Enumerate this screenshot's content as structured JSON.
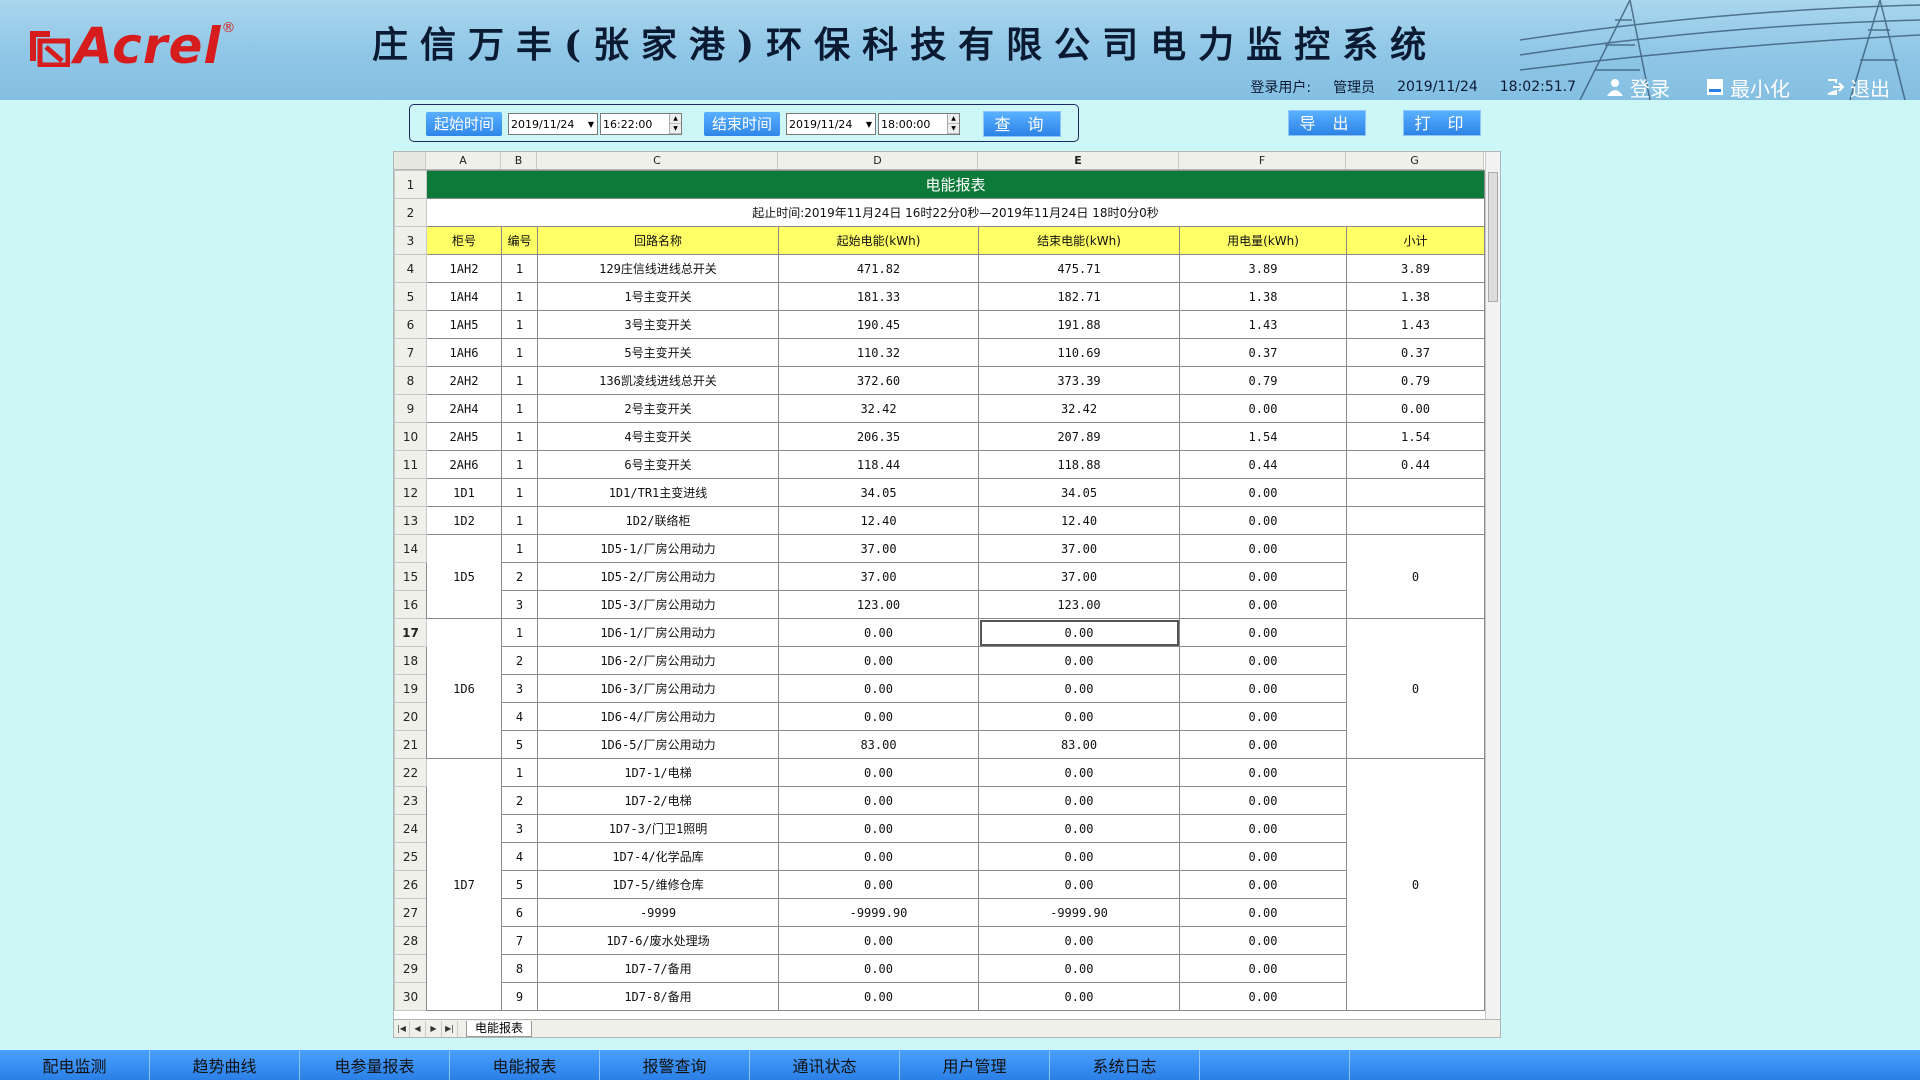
{
  "header": {
    "logo_text": "Acrel",
    "logo_reg": "®",
    "title": "庄信万丰(张家港)环保科技有限公司电力监控系统",
    "user_label": "登录用户:",
    "user_name": "管理员",
    "date": "2019/11/24",
    "time": "18:02:51.7",
    "login_label": "登录",
    "minimize_label": "最小化",
    "exit_label": "退出"
  },
  "query": {
    "start_label": "起始时间",
    "start_date": "2019/11/24",
    "start_time": "16:22:00",
    "end_label": "结束时间",
    "end_date": "2019/11/24",
    "end_time": "18:00:00",
    "query_button": "查 询",
    "export_button": "导 出",
    "print_button": "打 印"
  },
  "sheet": {
    "columns": [
      "A",
      "B",
      "C",
      "D",
      "E",
      "F",
      "G"
    ],
    "title": "电能报表",
    "range": "起止时间:2019年11月24日 16时22分0秒—2019年11月24日 18时0分0秒",
    "headers": [
      "柜号",
      "编号",
      "回路名称",
      "起始电能(kWh)",
      "结束电能(kWh)",
      "用电量(kWh)",
      "小计"
    ],
    "rows": [
      {
        "rn": "4",
        "cab": "1AH2",
        "no": "1",
        "name": "129庄信线进线总开关",
        "start": "471.82",
        "end": "475.71",
        "use": "3.89",
        "sub": "3.89"
      },
      {
        "rn": "5",
        "cab": "1AH4",
        "no": "1",
        "name": "1号主变开关",
        "start": "181.33",
        "end": "182.71",
        "use": "1.38",
        "sub": "1.38"
      },
      {
        "rn": "6",
        "cab": "1AH5",
        "no": "1",
        "name": "3号主变开关",
        "start": "190.45",
        "end": "191.88",
        "use": "1.43",
        "sub": "1.43"
      },
      {
        "rn": "7",
        "cab": "1AH6",
        "no": "1",
        "name": "5号主变开关",
        "start": "110.32",
        "end": "110.69",
        "use": "0.37",
        "sub": "0.37"
      },
      {
        "rn": "8",
        "cab": "2AH2",
        "no": "1",
        "name": "136凯凌线进线总开关",
        "start": "372.60",
        "end": "373.39",
        "use": "0.79",
        "sub": "0.79"
      },
      {
        "rn": "9",
        "cab": "2AH4",
        "no": "1",
        "name": "2号主变开关",
        "start": "32.42",
        "end": "32.42",
        "use": "0.00",
        "sub": "0.00"
      },
      {
        "rn": "10",
        "cab": "2AH5",
        "no": "1",
        "name": "4号主变开关",
        "start": "206.35",
        "end": "207.89",
        "use": "1.54",
        "sub": "1.54"
      },
      {
        "rn": "11",
        "cab": "2AH6",
        "no": "1",
        "name": "6号主变开关",
        "start": "118.44",
        "end": "118.88",
        "use": "0.44",
        "sub": "0.44"
      },
      {
        "rn": "12",
        "cab": "1D1",
        "no": "1",
        "name": "1D1/TR1主变进线",
        "start": "34.05",
        "end": "34.05",
        "use": "0.00",
        "sub": ""
      },
      {
        "rn": "13",
        "cab": "1D2",
        "no": "1",
        "name": "1D2/联络柜",
        "start": "12.40",
        "end": "12.40",
        "use": "0.00",
        "sub": ""
      }
    ],
    "group_1D5": {
      "cab": "1D5",
      "sub": "0",
      "rows": [
        {
          "rn": "14",
          "no": "1",
          "name": "1D5-1/厂房公用动力",
          "start": "37.00",
          "end": "37.00",
          "use": "0.00"
        },
        {
          "rn": "15",
          "no": "2",
          "name": "1D5-2/厂房公用动力",
          "start": "37.00",
          "end": "37.00",
          "use": "0.00"
        },
        {
          "rn": "16",
          "no": "3",
          "name": "1D5-3/厂房公用动力",
          "start": "123.00",
          "end": "123.00",
          "use": "0.00"
        }
      ]
    },
    "group_1D6": {
      "cab": "1D6",
      "sub": "0",
      "rows": [
        {
          "rn": "17",
          "no": "1",
          "name": "1D6-1/厂房公用动力",
          "start": "0.00",
          "end": "0.00",
          "use": "0.00"
        },
        {
          "rn": "18",
          "no": "2",
          "name": "1D6-2/厂房公用动力",
          "start": "0.00",
          "end": "0.00",
          "use": "0.00"
        },
        {
          "rn": "19",
          "no": "3",
          "name": "1D6-3/厂房公用动力",
          "start": "0.00",
          "end": "0.00",
          "use": "0.00"
        },
        {
          "rn": "20",
          "no": "4",
          "name": "1D6-4/厂房公用动力",
          "start": "0.00",
          "end": "0.00",
          "use": "0.00"
        },
        {
          "rn": "21",
          "no": "5",
          "name": "1D6-5/厂房公用动力",
          "start": "83.00",
          "end": "83.00",
          "use": "0.00"
        }
      ]
    },
    "group_1D7": {
      "cab": "1D7",
      "sub": "0",
      "rows": [
        {
          "rn": "22",
          "no": "1",
          "name": "1D7-1/电梯",
          "start": "0.00",
          "end": "0.00",
          "use": "0.00"
        },
        {
          "rn": "23",
          "no": "2",
          "name": "1D7-2/电梯",
          "start": "0.00",
          "end": "0.00",
          "use": "0.00"
        },
        {
          "rn": "24",
          "no": "3",
          "name": "1D7-3/门卫1照明",
          "start": "0.00",
          "end": "0.00",
          "use": "0.00"
        },
        {
          "rn": "25",
          "no": "4",
          "name": "1D7-4/化学品库",
          "start": "0.00",
          "end": "0.00",
          "use": "0.00"
        },
        {
          "rn": "26",
          "no": "5",
          "name": "1D7-5/维修仓库",
          "start": "0.00",
          "end": "0.00",
          "use": "0.00"
        },
        {
          "rn": "27",
          "no": "6",
          "name": "-9999",
          "start": "-9999.90",
          "end": "-9999.90",
          "use": "0.00"
        },
        {
          "rn": "28",
          "no": "7",
          "name": "1D7-6/废水处理场",
          "start": "0.00",
          "end": "0.00",
          "use": "0.00"
        },
        {
          "rn": "29",
          "no": "8",
          "name": "1D7-7/备用",
          "start": "0.00",
          "end": "0.00",
          "use": "0.00"
        },
        {
          "rn": "30",
          "no": "9",
          "name": "1D7-8/备用",
          "start": "0.00",
          "end": "0.00",
          "use": "0.00"
        }
      ]
    },
    "sheet_tab": "电能报表"
  },
  "nav": [
    "配电监测",
    "趋势曲线",
    "电参量报表",
    "电能报表",
    "报警查询",
    "通讯状态",
    "用户管理",
    "系统日志",
    ""
  ],
  "colors": {
    "title_green": "#0e7a3a",
    "header_yellow": "#ffff66",
    "nav_blue": "#2a7fe6",
    "bg": "#cdf7f7"
  }
}
